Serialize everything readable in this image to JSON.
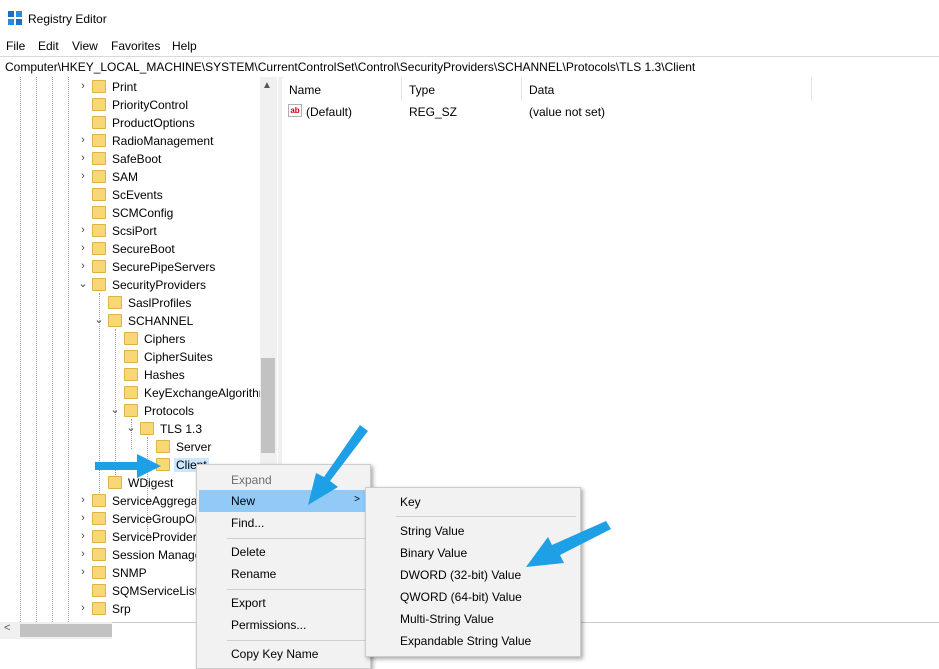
{
  "window": {
    "title": "Registry Editor"
  },
  "menu": [
    "File",
    "Edit",
    "View",
    "Favorites",
    "Help"
  ],
  "address": "Computer\\HKEY_LOCAL_MACHINE\\SYSTEM\\CurrentControlSet\\Control\\SecurityProviders\\SCHANNEL\\Protocols\\TLS 1.3\\Client",
  "tree": {
    "items": [
      {
        "label": "Print",
        "expandable": true
      },
      {
        "label": "PriorityControl",
        "expandable": false
      },
      {
        "label": "ProductOptions",
        "expandable": false
      },
      {
        "label": "RadioManagement",
        "expandable": true
      },
      {
        "label": "SafeBoot",
        "expandable": true
      },
      {
        "label": "SAM",
        "expandable": true
      },
      {
        "label": "ScEvents",
        "expandable": false
      },
      {
        "label": "SCMConfig",
        "expandable": false
      },
      {
        "label": "ScsiPort",
        "expandable": true
      },
      {
        "label": "SecureBoot",
        "expandable": true
      },
      {
        "label": "SecurePipeServers",
        "expandable": true
      },
      {
        "label": "SecurityProviders",
        "expandable": true,
        "expanded": true
      },
      {
        "label": "SaslProfiles",
        "expandable": false
      },
      {
        "label": "SCHANNEL",
        "expandable": true,
        "expanded": true
      },
      {
        "label": "Ciphers",
        "expandable": false
      },
      {
        "label": "CipherSuites",
        "expandable": false
      },
      {
        "label": "Hashes",
        "expandable": false
      },
      {
        "label": "KeyExchangeAlgorithms",
        "expandable": false
      },
      {
        "label": "Protocols",
        "expandable": true,
        "expanded": true
      },
      {
        "label": "TLS 1.3",
        "expandable": true,
        "expanded": true
      },
      {
        "label": "Server",
        "expandable": false
      },
      {
        "label": "Client",
        "expandable": false,
        "selected": true
      },
      {
        "label": "WDigest",
        "expandable": false
      },
      {
        "label": "ServiceAggregatedEvents",
        "expandable": true
      },
      {
        "label": "ServiceGroupOrder",
        "expandable": true
      },
      {
        "label": "ServiceProvider",
        "expandable": true
      },
      {
        "label": "Session Manager",
        "expandable": true
      },
      {
        "label": "SNMP",
        "expandable": true
      },
      {
        "label": "SQMServiceList",
        "expandable": false
      },
      {
        "label": "Srp",
        "expandable": true
      }
    ]
  },
  "values_pane": {
    "columns": [
      "Name",
      "Type",
      "Data"
    ],
    "rows": [
      {
        "name": "(Default)",
        "type": "REG_SZ",
        "data": "(value not set)"
      }
    ]
  },
  "context_menu": {
    "items": [
      {
        "label": "Expand",
        "disabled": true
      },
      {
        "label": "New",
        "submenu": true,
        "highlighted": true
      },
      {
        "label": "Find..."
      },
      {
        "separator": true
      },
      {
        "label": "Delete"
      },
      {
        "label": "Rename"
      },
      {
        "separator": true
      },
      {
        "label": "Export"
      },
      {
        "label": "Permissions..."
      },
      {
        "separator": true
      },
      {
        "label": "Copy Key Name"
      }
    ]
  },
  "submenu": {
    "items": [
      {
        "label": "Key"
      },
      {
        "separator": true
      },
      {
        "label": "String Value"
      },
      {
        "label": "Binary Value"
      },
      {
        "label": "DWORD (32-bit) Value"
      },
      {
        "label": "QWORD (64-bit) Value"
      },
      {
        "label": "Multi-String Value"
      },
      {
        "label": "Expandable String Value"
      }
    ]
  },
  "icons": {
    "app": "registry-editor-icon",
    "value_type": "string-value-icon"
  },
  "colors": {
    "highlight": "#91c9f7",
    "folder": "#f8d776",
    "arrow": "#1ea0e6"
  }
}
